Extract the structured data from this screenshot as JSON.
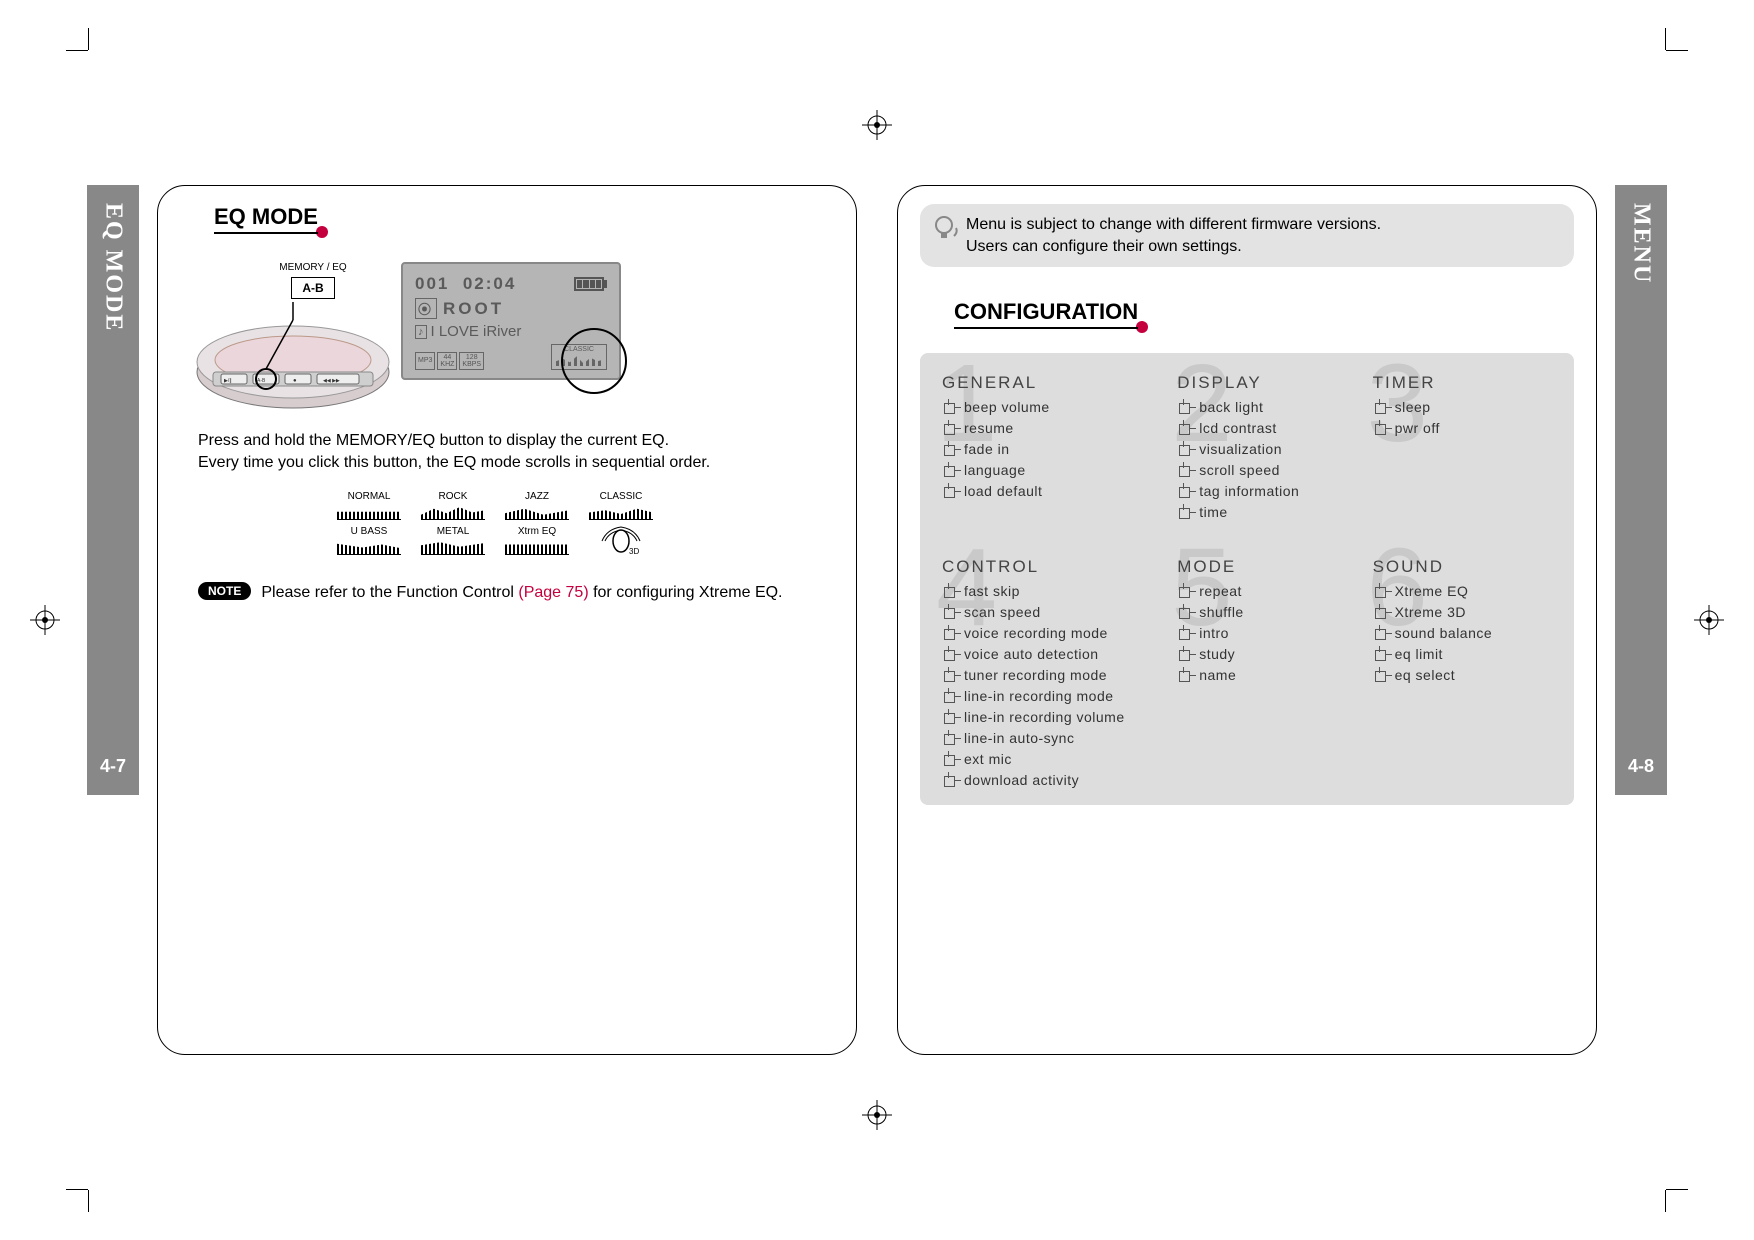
{
  "left_tab": {
    "label": "EQ MODE",
    "page": "4-7"
  },
  "right_tab": {
    "label": "MENU",
    "page": "4-8"
  },
  "left": {
    "title": "EQ MODE",
    "callout_caption": "MEMORY / EQ",
    "callout_button": "A-B",
    "lcd": {
      "track": "001",
      "time": "02:04",
      "root": "ROOT",
      "song": "I LOVE iRiver",
      "fmt": "MP3",
      "khz_top": "44",
      "khz_bot": "KHZ",
      "kbps_top": "128",
      "kbps_bot": "KBPS",
      "eq_label": "CLASSIC"
    },
    "body1": "Press and hold the MEMORY/EQ button to display the current EQ.",
    "body2": "Every time you click this button, the EQ mode scrolls in sequential order.",
    "eq_modes": [
      "NORMAL",
      "ROCK",
      "JAZZ",
      "CLASSIC",
      "U BASS",
      "METAL",
      "Xtrm EQ"
    ],
    "eq_3d": "3D",
    "note_label": "NOTE",
    "note_pre": "Please refer to the Function Control ",
    "note_link": "(Page 75)",
    "note_post": " for configuring Xtreme EQ."
  },
  "right": {
    "info1": "Menu is subject to change with different firmware versions.",
    "info2": "Users can configure their own settings.",
    "title": "CONFIGURATION",
    "sections": [
      {
        "num": "1",
        "head": "GENERAL",
        "items": [
          "beep volume",
          "resume",
          "fade in",
          "language",
          "load default"
        ]
      },
      {
        "num": "2",
        "head": "DISPLAY",
        "items": [
          "back light",
          "lcd contrast",
          "visualization",
          "scroll speed",
          "tag information",
          "time"
        ]
      },
      {
        "num": "3",
        "head": "TIMER",
        "items": [
          "sleep",
          "pwr off"
        ]
      },
      {
        "num": "4",
        "head": "CONTROL",
        "items": [
          "fast skip",
          "scan speed",
          "voice recording mode",
          "voice auto detection",
          "tuner recording mode",
          "line-in recording mode",
          "line-in recording volume",
          "line-in auto-sync",
          "ext mic",
          "download activity"
        ]
      },
      {
        "num": "5",
        "head": "MODE",
        "items": [
          "repeat",
          "shuffle",
          "intro",
          "study",
          "name"
        ]
      },
      {
        "num": "6",
        "head": "SOUND",
        "items": [
          "Xtreme EQ",
          "Xtreme 3D",
          "sound balance",
          "eq limit",
          "eq select"
        ]
      }
    ]
  }
}
